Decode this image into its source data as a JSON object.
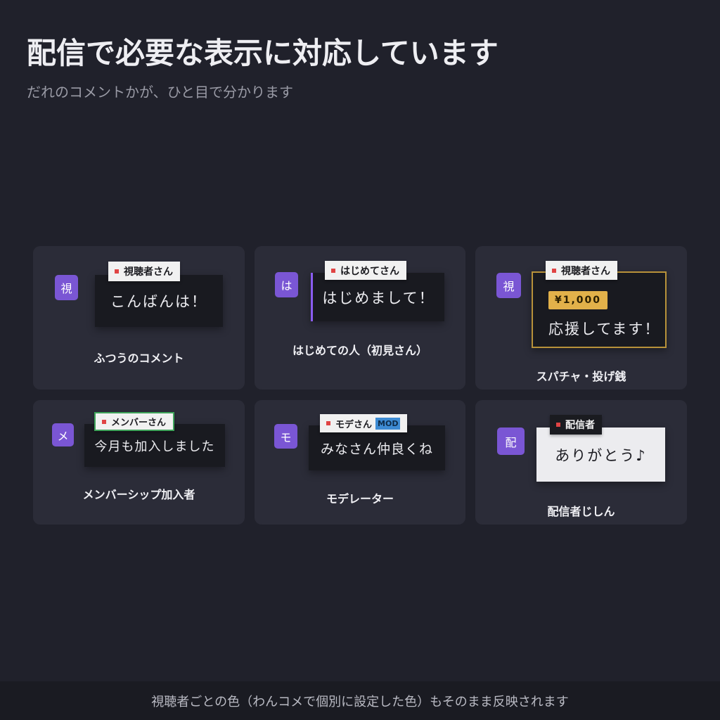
{
  "header": {
    "title": "配信で必要な表示に対応しています",
    "subtitle": "だれのコメントかが、ひと目で分かります"
  },
  "cards": [
    {
      "avatar": "視",
      "tag": "視聴者さん",
      "message": "こんばんは！",
      "caption": "ふつうのコメント"
    },
    {
      "avatar": "は",
      "tag": "はじめてさん",
      "message": "はじめまして！",
      "caption": "はじめての人（初見さん）",
      "accent": "#8a5cf0"
    },
    {
      "avatar": "視",
      "tag": "視聴者さん",
      "price": "¥1,000",
      "message": "応援してます！",
      "caption": "スパチャ・投げ銭",
      "accent": "#b8923a"
    },
    {
      "avatar": "メ",
      "tag": "メンバーさん",
      "message": "今月も加入しました",
      "caption": "メンバーシップ加入者",
      "accent": "#3ea35a"
    },
    {
      "avatar": "モ",
      "tag": "モデさん",
      "badge": "MOD",
      "message": "みなさん仲良くね",
      "caption": "モデレーター"
    },
    {
      "avatar": "配",
      "tag": "配信者",
      "message": "ありがとう♪",
      "caption": "配信者じしん"
    }
  ],
  "footer": {
    "text": "視聴者ごとの色（わんコメで個別に設定した色）もそのまま反映されます"
  }
}
